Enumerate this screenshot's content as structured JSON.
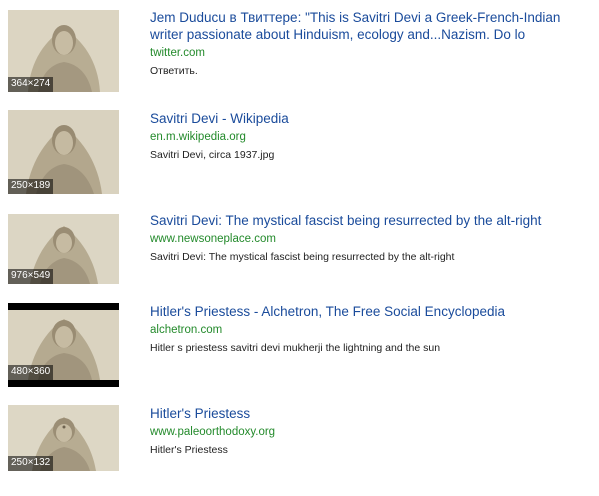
{
  "results": [
    {
      "title": "Jem Duducu в Твиттере: \"This is Savitri Devi a Greek-French-Indian writer passionate about Hinduism, ecology and...Nazism. Do lo",
      "url": "twitter.com",
      "snippet": "Ответить.",
      "dims": "364×274"
    },
    {
      "title": "Savitri Devi - Wikipedia",
      "url": "en.m.wikipedia.org",
      "snippet": "Savitri Devi, circa 1937.jpg",
      "dims": "250×189"
    },
    {
      "title": "Savitri Devi: The mystical fascist being resurrected by the alt-right",
      "url": "www.newsoneplace.com",
      "snippet": "Savitri Devi: The mystical fascist being resurrected by the alt-right",
      "dims": "976×549"
    },
    {
      "title": "Hitler's Priestess - Alchetron, The Free Social Encyclopedia",
      "url": "alchetron.com",
      "snippet": "Hitler s priestess savitri devi mukherji the lightning and the sun",
      "dims": "480×360"
    },
    {
      "title": "Hitler's Priestess",
      "url": "www.paleoorthodoxy.org",
      "snippet": "Hitler's Priestess",
      "dims": "250×132"
    }
  ]
}
